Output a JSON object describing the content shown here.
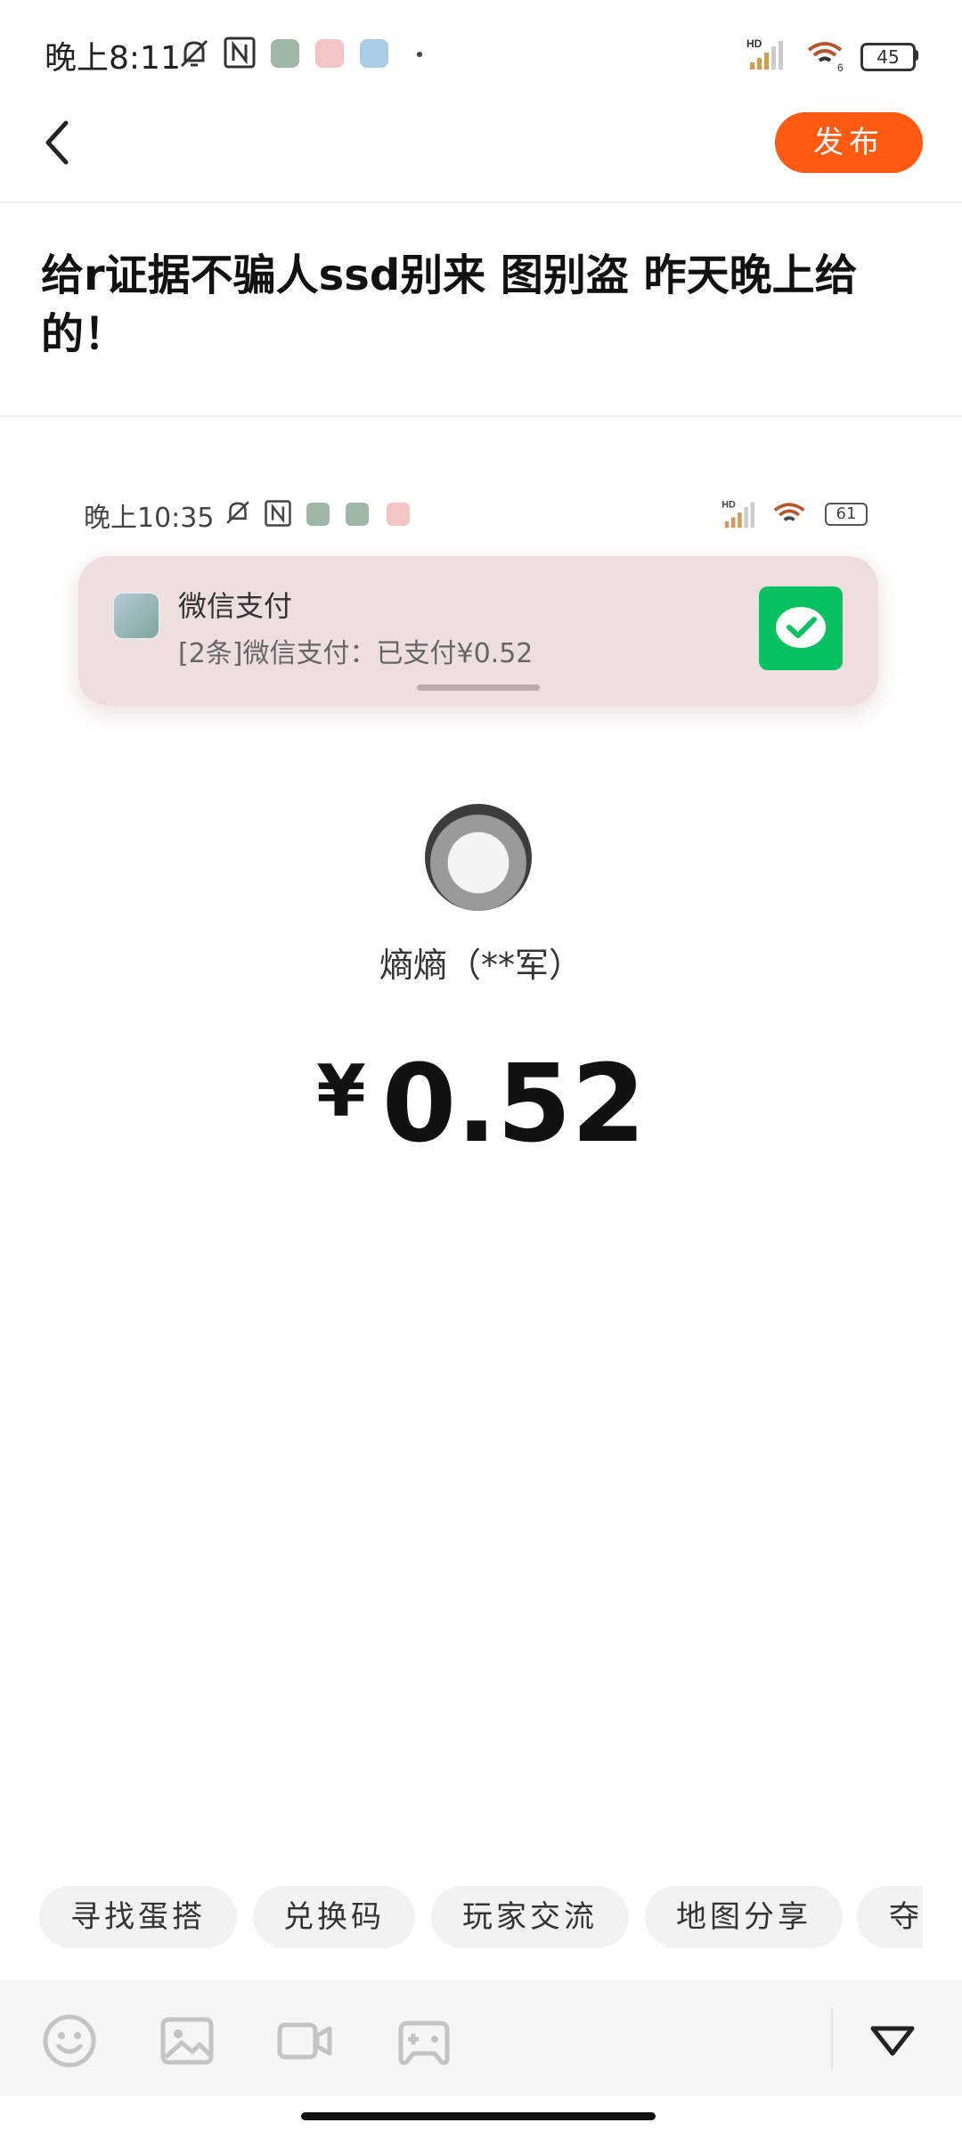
{
  "status_bar": {
    "time": "晚上8:11",
    "battery": "45"
  },
  "header": {
    "publish_label": "发布"
  },
  "post": {
    "title": "给r证据不骗人ssd别来 图别盗 昨天晚上给的！"
  },
  "screenshot": {
    "time": "晚上10:35",
    "battery": "61",
    "notification": {
      "title": "微信支付",
      "body": "[2条]微信支付：已支付¥0.52"
    },
    "payee_name": "熵熵（**军）",
    "currency_symbol": "¥",
    "amount": "0.52"
  },
  "tags": [
    "寻找蛋搭",
    "兑换码",
    "玩家交流",
    "地图分享",
    "夺"
  ],
  "colors": {
    "accent": "#ff5a0f",
    "wechat_green": "#08c160",
    "notification_bg": "#efdede"
  },
  "toolbar_icons": [
    "emoji-icon",
    "image-icon",
    "video-icon",
    "gamepad-icon",
    "collapse-triangle-icon"
  ]
}
